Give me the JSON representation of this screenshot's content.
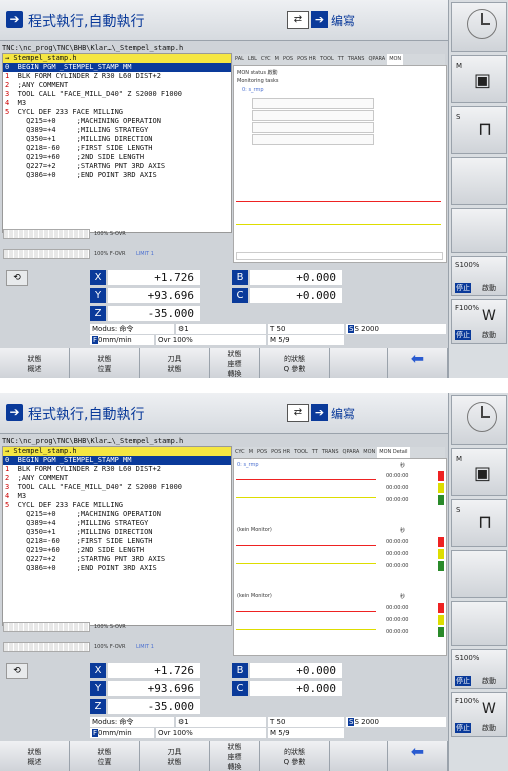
{
  "top": {
    "mode_title": "程式執行,自動執行",
    "edit_label": "编寫",
    "program_path": "TNC:\\nc_prog\\TNC\\BHB\\Klar…\\_Stempel_stamp.h",
    "program": [
      {
        "num": "",
        "text": "→ Stempel_stamp.h",
        "style": "hdr"
      },
      {
        "num": "0",
        "text": "  BEGIN PGM _STEMPEL_STAMP MM",
        "style": "sel"
      },
      {
        "num": "1",
        "text": "  BLK FORM CYLINDER Z R30 L60 DIST+2",
        "style": ""
      },
      {
        "num": "2",
        "text": "  ;ANY COMMENT",
        "style": ""
      },
      {
        "num": "3",
        "text": "  TOOL CALL \"FACE_MILL_D40\" Z S2000 F1000",
        "style": ""
      },
      {
        "num": "4",
        "text": "  M3",
        "style": ""
      },
      {
        "num": "5",
        "text": "  CYCL DEF 233 FACE MILLING",
        "style": ""
      },
      {
        "num": "",
        "text": "     Q215=+0     ;MACHINING OPERATION",
        "style": ""
      },
      {
        "num": "",
        "text": "     Q389=+4     ;MILLING STRATEGY",
        "style": ""
      },
      {
        "num": "",
        "text": "     Q350=+1     ;MILLING DIRECTION",
        "style": ""
      },
      {
        "num": "",
        "text": "     Q218=-60    ;FIRST SIDE LENGTH",
        "style": ""
      },
      {
        "num": "",
        "text": "     Q219=+60    ;2ND SIDE LENGTH",
        "style": ""
      },
      {
        "num": "",
        "text": "     Q227=+2     ;STARTNG PNT 3RD AXIS",
        "style": ""
      },
      {
        "num": "",
        "text": "     Q386=+0     ;END POINT 3RD AXIS",
        "style": ""
      }
    ],
    "tabs": [
      "PAL",
      "LBL",
      "CYC",
      "M",
      "POS",
      "POS HR",
      "TOOL",
      "TT",
      "TRANS",
      "QPARA",
      "MON"
    ],
    "monitor_status_label": "MON status 啟動",
    "monitoring_tasks": "Monitoring tasks",
    "task_item": "0: s_rmp",
    "s_ovr": "100% S-OVR",
    "f_ovr": "100% F-OVR",
    "limit": "LIMIT 1"
  },
  "bottom": {
    "tabs": [
      "CYC",
      "M",
      "POS",
      "POS HR",
      "TOOL",
      "TT",
      "TRANS",
      "QPARA",
      "MON",
      "MON Detail"
    ],
    "monitors": [
      {
        "name": "0: s_rmp",
        "unit": "秒",
        "times": [
          "00:00:00",
          "00:00:00",
          "00:00:00"
        ]
      },
      {
        "name": "(kein Monitor)",
        "unit": "秒",
        "times": [
          "00:00:00",
          "00:00:00",
          "00:00:00"
        ]
      },
      {
        "name": "(kein Monitor)",
        "unit": "秒",
        "times": [
          "00:00:00",
          "00:00:00",
          "00:00:00"
        ]
      }
    ]
  },
  "axes": [
    {
      "label": "X",
      "value": "+1.726"
    },
    {
      "label": "Y",
      "value": "+93.696"
    },
    {
      "label": "Z",
      "value": "-35.000"
    },
    {
      "label": "B",
      "value": "+0.000"
    },
    {
      "label": "C",
      "value": "+0.000"
    }
  ],
  "status": {
    "modus": "Modus: 命令",
    "tool_num": "1",
    "f_value": "0mm/min",
    "ovr": "Ovr 100%",
    "t_value": "T 50",
    "s_value": "S 2000",
    "m_value": "M 5/9"
  },
  "softkeys": [
    {
      "line1": "狀態",
      "line2": "概述"
    },
    {
      "line1": "狀態",
      "line2": "位置"
    },
    {
      "line1": "刀具",
      "line2": "狀態"
    },
    {
      "line1": "狀態",
      "line2": "座標",
      "line3": "轉換"
    },
    {
      "line1": "的狀態",
      "line2": "Q 參數"
    }
  ],
  "side": {
    "m_label": "M",
    "s_label": "S",
    "s100": "S100%",
    "f100": "F100%",
    "stop": "停止",
    "start": "啟動"
  }
}
